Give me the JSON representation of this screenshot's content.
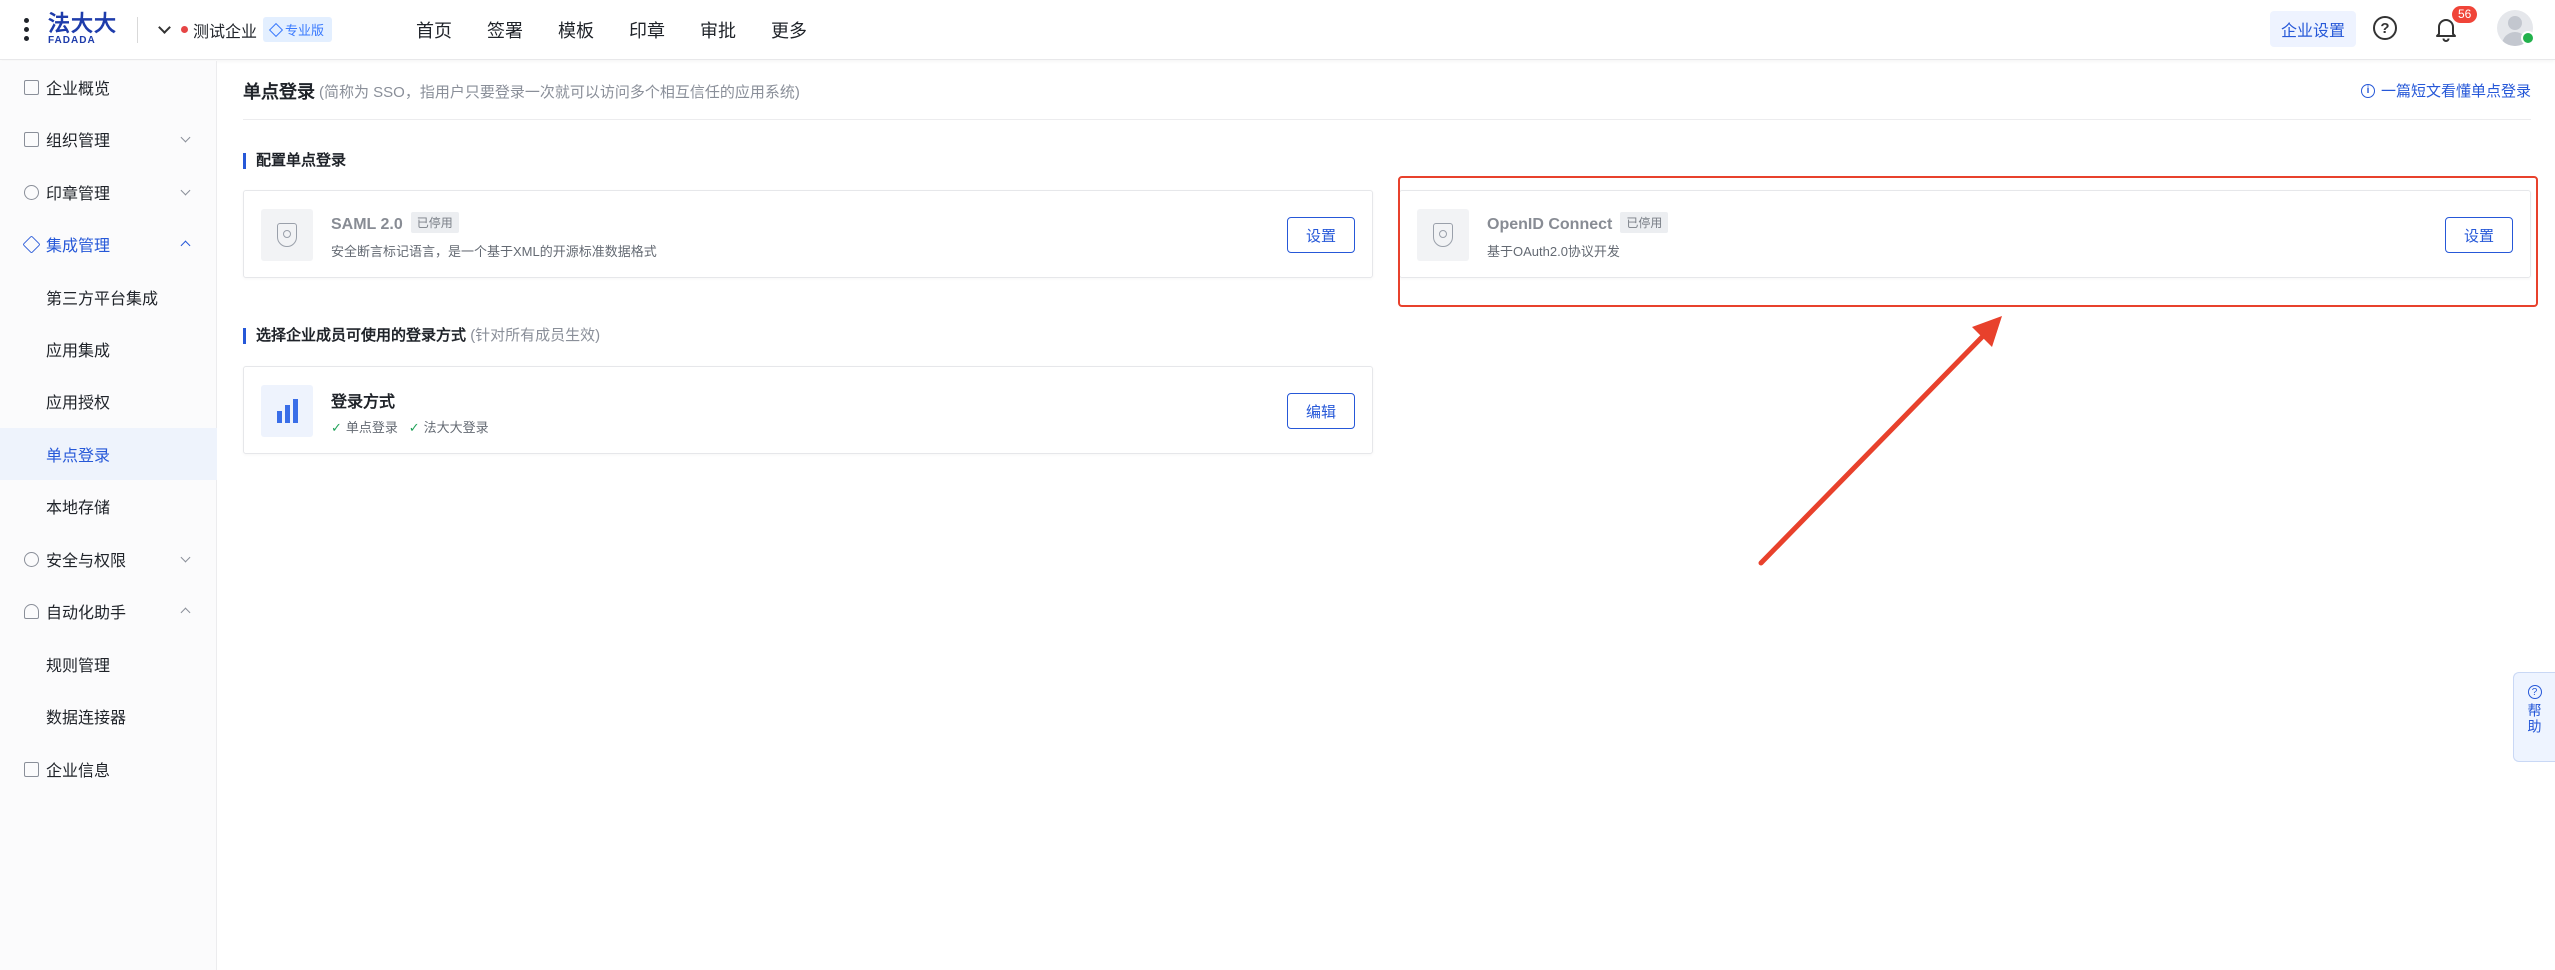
{
  "header": {
    "logo_cn": "法大大",
    "logo_en": "FADADA",
    "company": "测试企业",
    "edition": "专业版",
    "nav": [
      "首页",
      "签署",
      "模板",
      "印章",
      "审批",
      "更多"
    ],
    "enterprise_settings": "企业设置",
    "notification_count": "56"
  },
  "sidebar": {
    "items": [
      {
        "label": "企业概览",
        "icon": "overview-icon"
      },
      {
        "label": "组织管理",
        "icon": "org-icon"
      },
      {
        "label": "印章管理",
        "icon": "seal-icon"
      },
      {
        "label": "集成管理",
        "icon": "integration-icon"
      },
      {
        "label": "第三方平台集成"
      },
      {
        "label": "应用集成"
      },
      {
        "label": "应用授权"
      },
      {
        "label": "单点登录"
      },
      {
        "label": "本地存储"
      },
      {
        "label": "安全与权限",
        "icon": "security-icon"
      },
      {
        "label": "自动化助手",
        "icon": "automation-icon"
      },
      {
        "label": "规则管理"
      },
      {
        "label": "数据连接器"
      },
      {
        "label": "企业信息",
        "icon": "company-info-icon"
      }
    ]
  },
  "main": {
    "title": "单点登录",
    "description": "(简称为 SSO，指用户只要登录一次就可以访问多个相互信任的应用系统)",
    "doc_link": "一篇短文看懂单点登录",
    "section1": "配置单点登录",
    "section2": "选择企业成员可使用的登录方式",
    "section2_note": "(针对所有成员生效)",
    "cards": [
      {
        "title": "SAML 2.0",
        "tag": "已停用",
        "desc": "安全断言标记语言，是一个基于XML的开源标准数据格式",
        "button": "设置"
      },
      {
        "title": "OpenID Connect",
        "tag": "已停用",
        "desc": "基于OAuth2.0协议开发",
        "button": "设置"
      }
    ],
    "login_card": {
      "title": "登录方式",
      "methods": [
        "单点登录",
        "法大大登录"
      ],
      "button": "编辑"
    }
  },
  "float_help": "帮助",
  "colors": {
    "accent": "#2658d8",
    "highlight": "#e8412c",
    "arrow": "#e8412c"
  }
}
